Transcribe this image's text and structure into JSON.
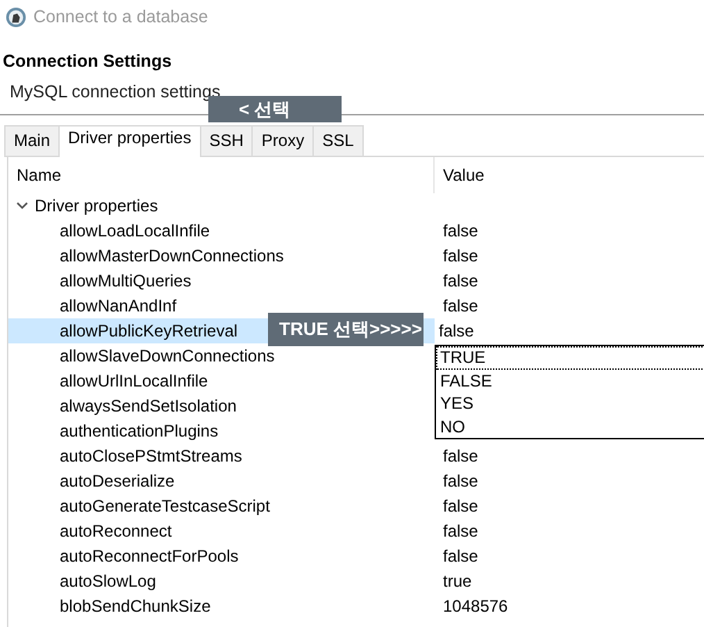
{
  "window": {
    "title": "Connect to a database"
  },
  "header": {
    "title": "Connection Settings",
    "subtitle": "MySQL connection settings"
  },
  "tabs": [
    {
      "label": "Main",
      "selected": false
    },
    {
      "label": "Driver properties",
      "selected": true
    },
    {
      "label": "SSH",
      "selected": false
    },
    {
      "label": "Proxy",
      "selected": false
    },
    {
      "label": "SSL",
      "selected": false
    }
  ],
  "table": {
    "columns": [
      "Name",
      "Value"
    ],
    "groups": [
      {
        "label": "Driver properties",
        "expanded": true,
        "rows": [
          {
            "name": "allowLoadLocalInfile",
            "value": "false",
            "selected": false
          },
          {
            "name": "allowMasterDownConnections",
            "value": "false",
            "selected": false
          },
          {
            "name": "allowMultiQueries",
            "value": "false",
            "selected": false
          },
          {
            "name": "allowNanAndInf",
            "value": "false",
            "selected": false
          },
          {
            "name": "allowPublicKeyRetrieval",
            "value": "false",
            "selected": true
          },
          {
            "name": "allowSlaveDownConnections",
            "selected": false
          },
          {
            "name": "allowUrlInLocalInfile",
            "selected": false
          },
          {
            "name": "alwaysSendSetIsolation",
            "selected": false
          },
          {
            "name": "authenticationPlugins",
            "selected": false
          },
          {
            "name": "autoClosePStmtStreams",
            "value": "false",
            "selected": false
          },
          {
            "name": "autoDeserialize",
            "value": "false",
            "selected": false
          },
          {
            "name": "autoGenerateTestcaseScript",
            "value": "false",
            "selected": false
          },
          {
            "name": "autoReconnect",
            "value": "false",
            "selected": false
          },
          {
            "name": "autoReconnectForPools",
            "value": "false",
            "selected": false
          },
          {
            "name": "autoSlowLog",
            "value": "true",
            "selected": false
          },
          {
            "name": "blobSendChunkSize",
            "value": "1048576",
            "selected": false
          }
        ]
      }
    ]
  },
  "dropdown": {
    "options": [
      {
        "label": "TRUE",
        "focused": true
      },
      {
        "label": "FALSE",
        "focused": false
      },
      {
        "label": "YES",
        "focused": false
      },
      {
        "label": "NO",
        "focused": false
      }
    ]
  },
  "annotations": [
    {
      "kind": "tabs",
      "text": "< 선택"
    },
    {
      "kind": "row",
      "text": "TRUE 선택>>>>>"
    }
  ]
}
